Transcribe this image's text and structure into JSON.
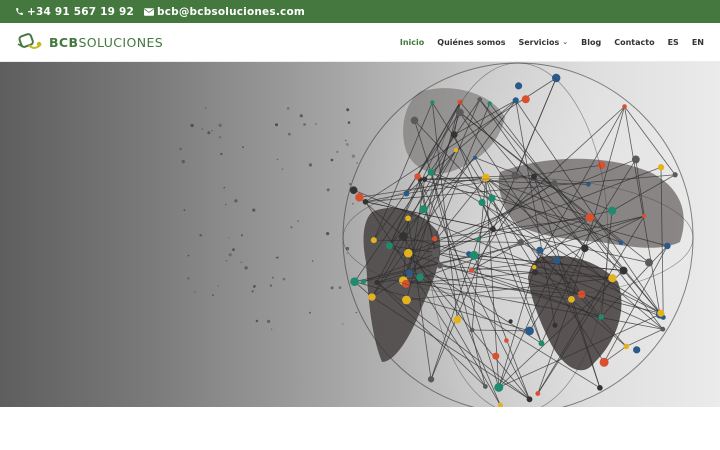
{
  "topbar": {
    "phone": "+34 91 567 19 92",
    "email": "bcb@bcbsoluciones.com",
    "phone_icon": "phone-icon",
    "email_icon": "envelope-icon",
    "background_color": "#44783f"
  },
  "logo": {
    "brand_bold": "BCB",
    "brand_light": "SOLUCIONES",
    "color": "#44783f",
    "accent_color": "#c8b820"
  },
  "nav": {
    "items": [
      {
        "label": "Inicio",
        "active": true
      },
      {
        "label": "Quiénes somos",
        "active": false
      },
      {
        "label": "Servicios",
        "active": false,
        "has_dropdown": true
      },
      {
        "label": "Blog",
        "active": false
      },
      {
        "label": "Contacto",
        "active": false
      },
      {
        "label": "ES",
        "active": false
      },
      {
        "label": "EN",
        "active": false
      }
    ],
    "dropdown_icon": "chevron-down-icon"
  },
  "hero": {
    "image": "network-globe-illustration",
    "node_colors": [
      "#1f8a6e",
      "#d9502e",
      "#e3b21f",
      "#2b5a8a",
      "#333333",
      "#5a5a5a"
    ]
  }
}
